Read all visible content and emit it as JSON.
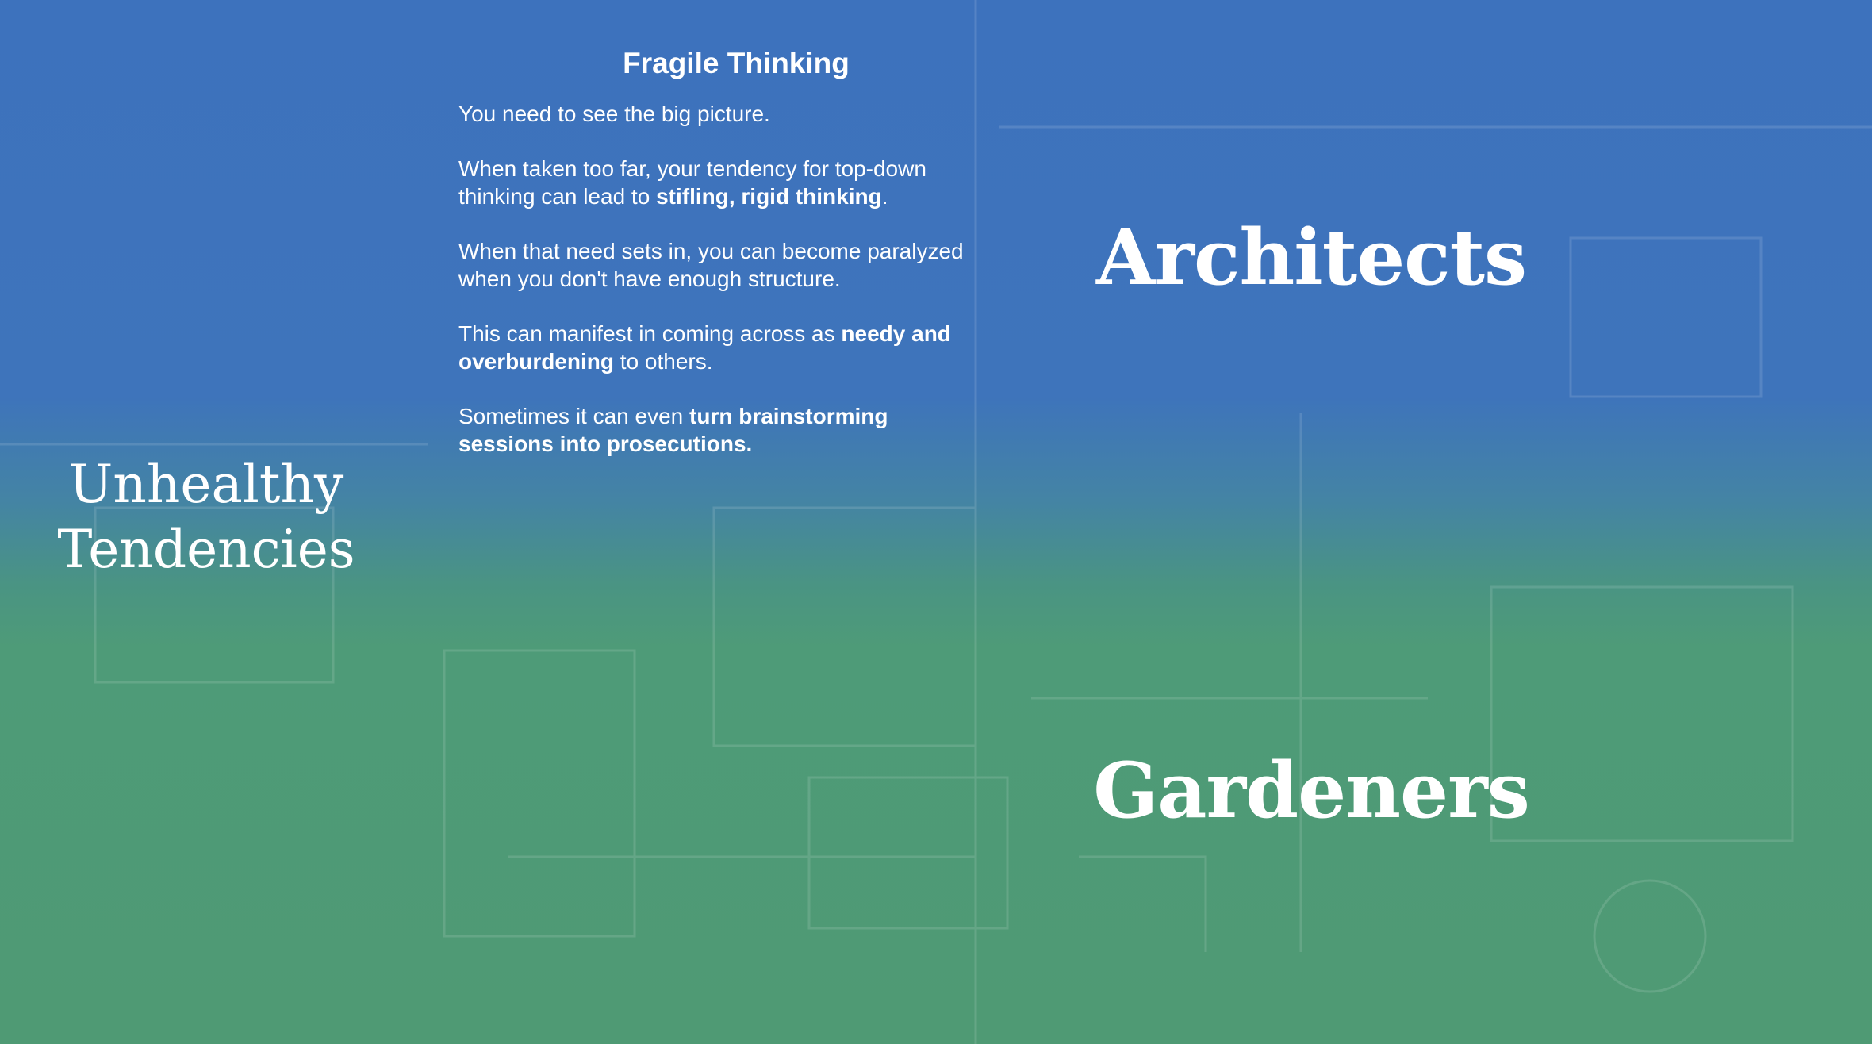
{
  "left_heading": {
    "line1": "Unhealthy",
    "line2": "Tendencies"
  },
  "panel": {
    "title": "Fragile Thinking",
    "p1": "You need to see the big picture.",
    "p2": {
      "a": "When taken too far, your tendency for top-down thinking can lead to ",
      "b": "stifling, rigid thinking",
      "c": "."
    },
    "p3": "When that need sets in, you can become paralyzed when you don't have enough structure.",
    "p4": {
      "a": "This can manifest in coming across as ",
      "b": "needy and overburdening",
      "c": " to others."
    },
    "p5": {
      "a": "Sometimes it can even ",
      "b": "turn brainstorming sessions into prosecutions."
    }
  },
  "labels": {
    "top": "Architects",
    "bottom": "Gardeners"
  },
  "colors": {
    "top_background": "#3d72bd",
    "bottom_background": "#4f9a74",
    "text": "#ffffff"
  }
}
